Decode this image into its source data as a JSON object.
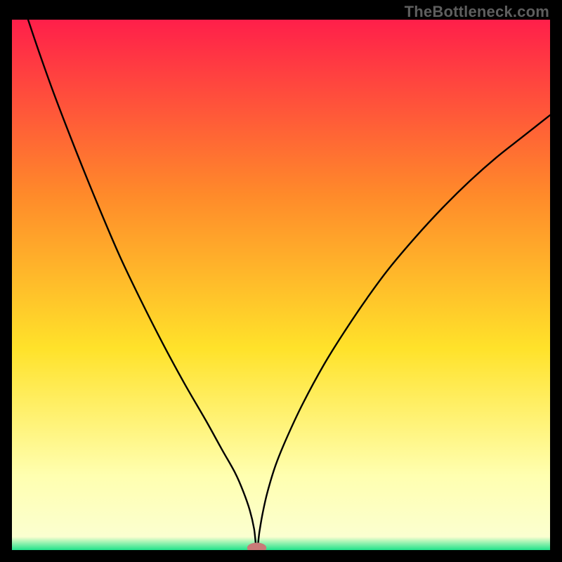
{
  "watermark": "TheBottleneck.com",
  "chart_data": {
    "type": "line",
    "title": "",
    "xlabel": "",
    "ylabel": "",
    "xlim": [
      0,
      100
    ],
    "ylim": [
      0,
      100
    ],
    "grid": false,
    "legend": false,
    "background_gradient": {
      "top_color": "#ff1f4a",
      "mid1_color": "#ff8a2a",
      "mid2_color": "#ffe22a",
      "band_color": "#ffffb0",
      "bottom_color": "#20e28a"
    },
    "marker": {
      "x": 45.5,
      "y": 0,
      "color": "#c97a78",
      "rx": 1.8,
      "ry": 1.0
    },
    "series": [
      {
        "name": "bottleneck-curve",
        "x": [
          3,
          5,
          8,
          12,
          16,
          20,
          24,
          28,
          32,
          36,
          39,
          41.5,
          43,
          44.2,
          45,
          45.5,
          46,
          46.6,
          47.5,
          49,
          51,
          54,
          58,
          62,
          66,
          70,
          75,
          80,
          85,
          90,
          95,
          100
        ],
        "y": [
          100,
          94,
          85.5,
          75,
          65,
          55.5,
          47,
          39,
          31.5,
          24.5,
          19,
          14.5,
          11,
          7.5,
          4,
          0,
          3.5,
          7,
          11,
          16,
          21,
          27.5,
          35,
          41.5,
          47.5,
          53,
          59,
          64.5,
          69.5,
          74,
          78,
          82
        ]
      }
    ]
  }
}
